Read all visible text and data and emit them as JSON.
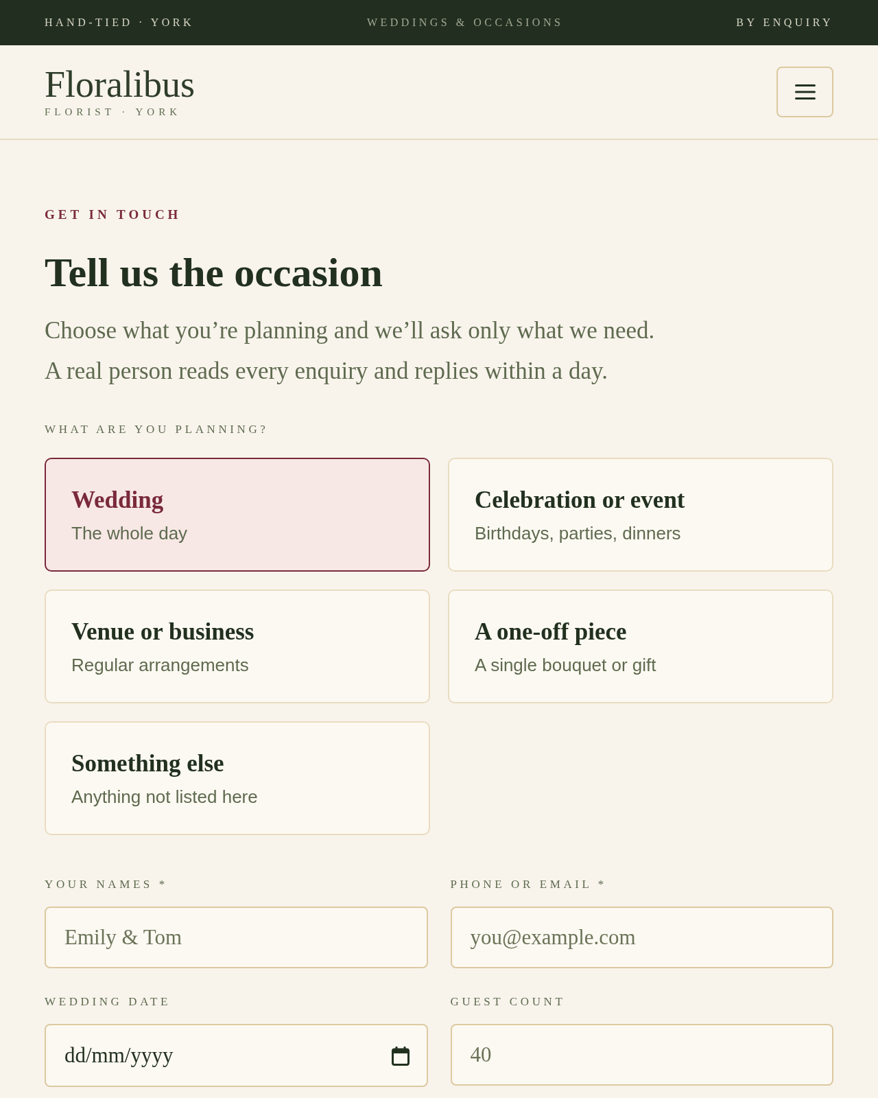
{
  "top_bar": {
    "left": "HAND-TIED · YORK",
    "center": "WEDDINGS & OCCASIONS",
    "right": "BY ENQUIRY"
  },
  "header": {
    "logo": "Floralibus",
    "tagline": "FLORIST · YORK"
  },
  "intro": {
    "eyebrow": "GET IN TOUCH",
    "title": "Tell us the occasion",
    "lines": [
      "Choose what you’re planning and we’ll ask only what we need.",
      "A real person reads every enquiry and replies within a day."
    ]
  },
  "occasions": {
    "label": "WHAT ARE YOU PLANNING?",
    "options": [
      {
        "title": "Wedding",
        "subtitle": "The whole day",
        "selected": true
      },
      {
        "title": "Celebration or event",
        "subtitle": "Birthdays, parties, dinners",
        "selected": false
      },
      {
        "title": "Venue or business",
        "subtitle": "Regular arrangements",
        "selected": false
      },
      {
        "title": "A one-off piece",
        "subtitle": "A single bouquet or gift",
        "selected": false
      },
      {
        "title": "Something else",
        "subtitle": "Anything not listed here",
        "selected": false
      }
    ]
  },
  "fields": [
    {
      "kind": "text",
      "label": "YOUR NAMES *",
      "placeholder": "Emily & Tom"
    },
    {
      "kind": "text",
      "label": "PHONE OR EMAIL *",
      "placeholder": "you@example.com"
    },
    {
      "kind": "date",
      "label": "WEDDING DATE",
      "placeholder": "dd/mm/yyyy"
    },
    {
      "kind": "number",
      "label": "GUEST COUNT",
      "placeholder": "40"
    }
  ]
}
